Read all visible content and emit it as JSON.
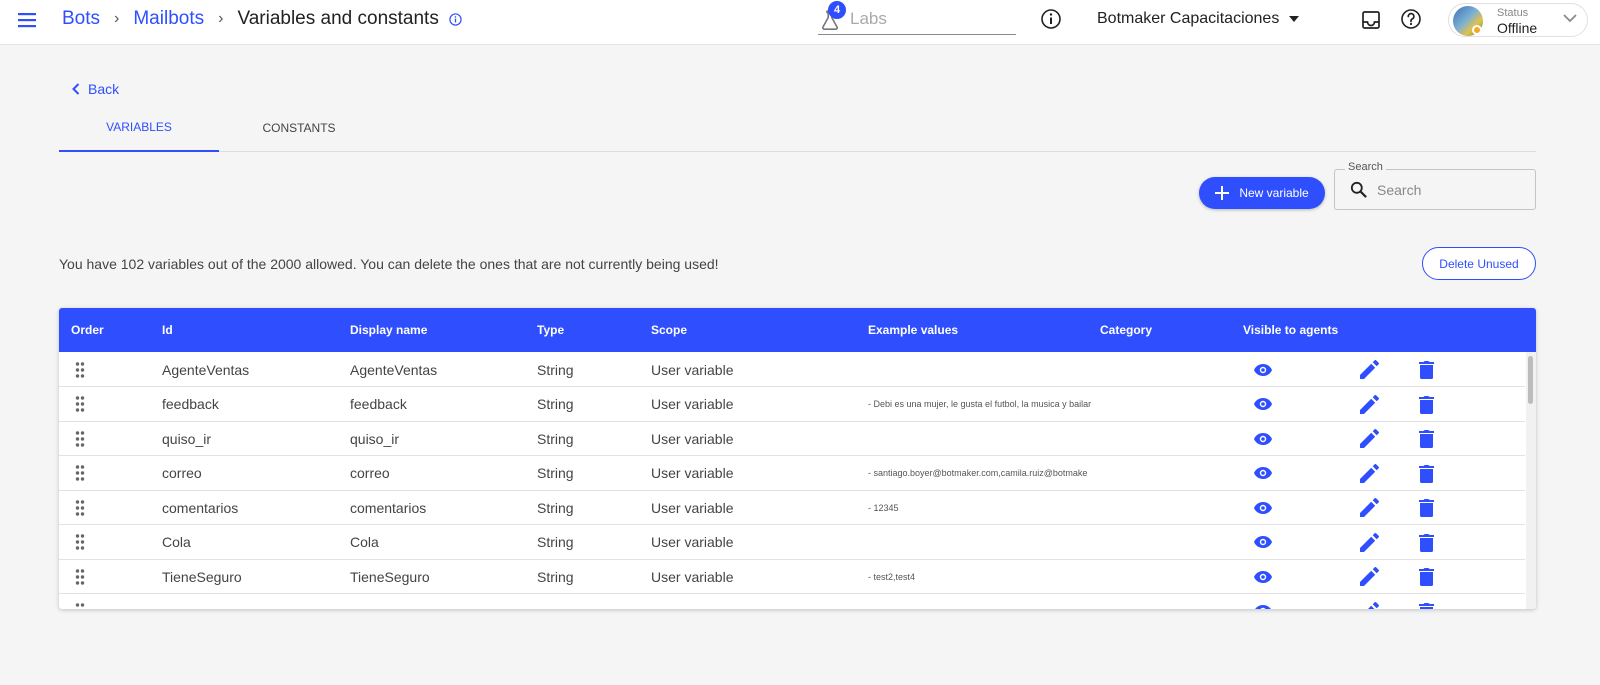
{
  "breadcrumb": {
    "items": [
      "Bots",
      "Mailbots"
    ],
    "current": "Variables and constants"
  },
  "labs": {
    "badge": "4",
    "placeholder": "Labs"
  },
  "account": {
    "name": "Botmaker Capacitaciones"
  },
  "status": {
    "label": "Status",
    "value": "Offline"
  },
  "back_label": "Back",
  "tabs": [
    {
      "label": "VARIABLES",
      "active": true
    },
    {
      "label": "CONSTANTS",
      "active": false
    }
  ],
  "actions": {
    "new_variable": "New variable",
    "delete_unused": "Delete Unused"
  },
  "search": {
    "label": "Search",
    "placeholder": "Search"
  },
  "info_text": "You have 102 variables out of the 2000 allowed. You can delete the ones that are not currently being used!",
  "table": {
    "headers": [
      "Order",
      "Id",
      "Display name",
      "Type",
      "Scope",
      "Example values",
      "Category",
      "Visible to agents"
    ],
    "rows": [
      {
        "id": "AgenteVentas",
        "display": "AgenteVentas",
        "type": "String",
        "scope": "User variable",
        "example": "",
        "category": ""
      },
      {
        "id": "feedback",
        "display": "feedback",
        "type": "String",
        "scope": "User variable",
        "example": "- Debi es una mujer, le gusta el futbol, la musica y bailar",
        "category": ""
      },
      {
        "id": "quiso_ir",
        "display": "quiso_ir",
        "type": "String",
        "scope": "User variable",
        "example": "",
        "category": ""
      },
      {
        "id": "correo",
        "display": "correo",
        "type": "String",
        "scope": "User variable",
        "example": "- santiago.boyer@botmaker.com,camila.ruiz@botmake",
        "category": ""
      },
      {
        "id": "comentarios",
        "display": "comentarios",
        "type": "String",
        "scope": "User variable",
        "example": "- 12345",
        "category": ""
      },
      {
        "id": "Cola",
        "display": "Cola",
        "type": "String",
        "scope": "User variable",
        "example": "",
        "category": ""
      },
      {
        "id": "TieneSeguro",
        "display": "TieneSeguro",
        "type": "String",
        "scope": "User variable",
        "example": "- test2,test4",
        "category": ""
      }
    ]
  },
  "colors": {
    "primary": "#2f4fff",
    "background": "#f5f5f5",
    "header_text": "#ffffff"
  }
}
